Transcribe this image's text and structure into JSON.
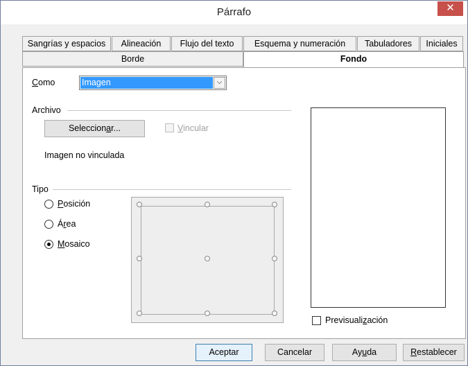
{
  "window": {
    "title": "Párrafo",
    "close_glyph": "✕"
  },
  "tabs": {
    "row1": [
      "Sangrías y espacios",
      "Alineación",
      "Flujo del texto",
      "Esquema y numeración",
      "Tabuladores",
      "Iniciales"
    ],
    "row2": [
      "Borde",
      "Fondo"
    ],
    "active": "Fondo"
  },
  "fondo": {
    "como_label_u": "C",
    "como_label_rest": "omo",
    "como_value": "Imagen",
    "dropdown_arrow": "⌵",
    "archivo_title": "Archivo",
    "select_btn_pre": "Seleccion",
    "select_btn_u": "a",
    "select_btn_post": "r...",
    "vincular_u": "V",
    "vincular_rest": "incular",
    "vincular_checked": false,
    "vincular_enabled": false,
    "link_status": "Imagen no vinculada",
    "tipo_title": "Tipo",
    "tipo_options": [
      {
        "u": "P",
        "rest": "osición",
        "selected": false
      },
      {
        "pre": "Á",
        "u": "r",
        "post": "ea",
        "selected": false
      },
      {
        "u": "M",
        "rest": "osaico",
        "selected": true
      }
    ],
    "preview_label_pre": "Previsuali",
    "preview_label_u": "z",
    "preview_label_post": "ación",
    "preview_checked": false
  },
  "buttons": {
    "ok": "Aceptar",
    "cancel": "Cancelar",
    "help_pre": "Ay",
    "help_u": "u",
    "help_post": "da",
    "reset_u": "R",
    "reset_rest": "establecer"
  }
}
